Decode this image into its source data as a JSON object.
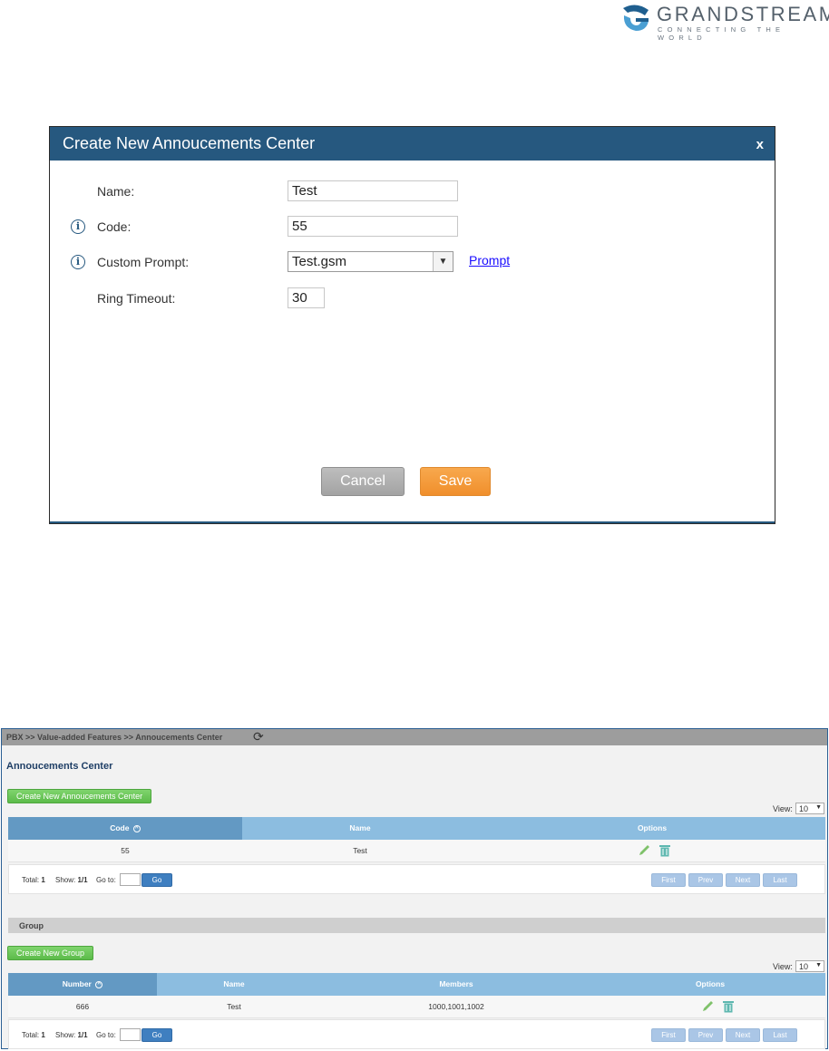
{
  "logo": {
    "name": "GRANDSTREAM",
    "tagline": "CONNECTING THE WORLD"
  },
  "dialog": {
    "title": "Create New Annoucements Center",
    "close": "x",
    "fields": {
      "name": {
        "label": "Name:",
        "value": "Test"
      },
      "code": {
        "label": "Code:",
        "value": "55"
      },
      "custom_prompt": {
        "label": "Custom Prompt:",
        "value": "Test.gsm",
        "link": "Prompt"
      },
      "ring_timeout": {
        "label": "Ring Timeout:",
        "value": "30"
      }
    },
    "cancel_label": "Cancel",
    "save_label": "Save",
    "header_color": "#26587f",
    "save_color": "#f08f2c"
  },
  "page": {
    "breadcrumb": "PBX >> Value-added Features >> Annoucements Center",
    "section_title": "Annoucements Center",
    "create_button": "Create New Annoucements Center",
    "view_label": "View:",
    "view_value": "10",
    "table": {
      "columns": [
        "Code",
        "Name",
        "Options"
      ],
      "rows": [
        {
          "code": "55",
          "name": "Test"
        }
      ]
    },
    "pager": {
      "total_label": "Total:",
      "total": "1",
      "show_label": "Show:",
      "show": "1/1",
      "goto_label": "Go to:",
      "go": "Go",
      "first": "First",
      "prev": "Prev",
      "next": "Next",
      "last": "Last"
    },
    "group": {
      "title": "Group",
      "create_button": "Create New Group",
      "view_label": "View:",
      "view_value": "10",
      "columns": [
        "Number",
        "Name",
        "Members",
        "Options"
      ],
      "rows": [
        {
          "number": "666",
          "name": "Test",
          "members": "1000,1001,1002"
        }
      ],
      "pager": {
        "total_label": "Total:",
        "total": "1",
        "show_label": "Show:",
        "show": "1/1",
        "goto_label": "Go to:",
        "go": "Go",
        "first": "First",
        "prev": "Prev",
        "next": "Next",
        "last": "Last"
      }
    }
  }
}
